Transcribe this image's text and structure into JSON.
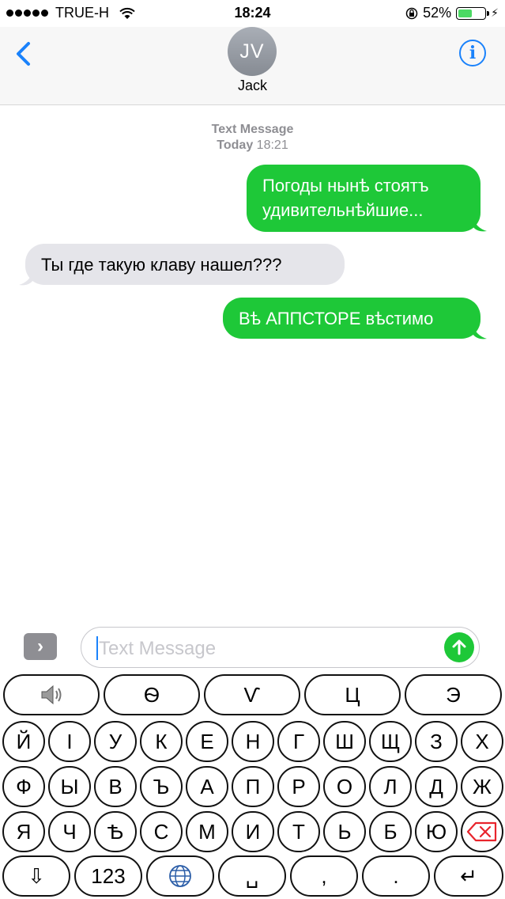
{
  "status_bar": {
    "carrier": "TRUE-H",
    "time": "18:24",
    "battery_percent": "52%",
    "battery_level": 0.52,
    "icons": [
      "signal-dots",
      "wifi-icon",
      "orientation-lock-icon",
      "battery-icon",
      "charging-bolt-icon"
    ]
  },
  "header": {
    "avatar_initials": "JV",
    "contact_name": "Jack",
    "info_label": "i",
    "accent_color": "#1a82fb"
  },
  "conversation": {
    "service_label": "Text Message",
    "date_label": "Today",
    "time_label": "18:21",
    "messages": [
      {
        "direction": "outgoing",
        "text_line1": "Погоды нынѣ стоятъ",
        "text_line2": "удивительнѣйшие..."
      },
      {
        "direction": "incoming",
        "text": "Ты где  такую клаву нашел???"
      },
      {
        "direction": "outgoing",
        "text": "Вѣ АППСТОРЕ вѣстимо"
      }
    ],
    "outgoing_color": "#1ec838",
    "incoming_color": "#e5e5ea"
  },
  "composer": {
    "expand_label": "›",
    "placeholder": "Text Message",
    "value": ""
  },
  "keyboard": {
    "row0": [
      "speaker-icon",
      "Ѳ",
      "Ѵ",
      "Ц",
      "Э"
    ],
    "row1": [
      "Й",
      "І",
      "У",
      "К",
      "Е",
      "Н",
      "Г",
      "Ш",
      "Щ",
      "З",
      "Х"
    ],
    "row2": [
      "Ф",
      "Ы",
      "В",
      "Ъ",
      "А",
      "П",
      "Р",
      "О",
      "Л",
      "Д",
      "Ж"
    ],
    "row3": [
      "Я",
      "Ч",
      "Ѣ",
      "С",
      "М",
      "И",
      "Т",
      "Ь",
      "Б",
      "Ю",
      "delete-icon"
    ],
    "row4": {
      "shift": "⇩",
      "numbers": "123",
      "globe": "globe-icon",
      "space": "␣",
      "comma": ",",
      "period": ".",
      "return": "↵"
    }
  }
}
